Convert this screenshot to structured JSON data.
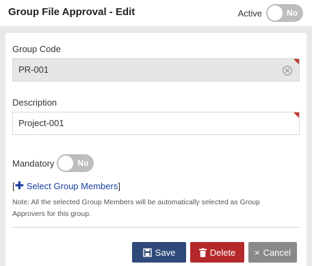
{
  "header": {
    "title": "Group File Approval - Edit",
    "active_label": "Active",
    "active_toggle": "No"
  },
  "form": {
    "group_code_label": "Group Code",
    "group_code_value": "PR-001",
    "description_label": "Description",
    "description_value": "Project-001",
    "mandatory_label": "Mandatory",
    "mandatory_toggle": "No",
    "select_members_open": "[",
    "select_members_label": "Select Group Members",
    "select_members_close": "]",
    "note": "Note: All the selected Group Members will be automatically selected as Group Approvers for this group."
  },
  "buttons": {
    "save": "Save",
    "delete": "Delete",
    "cancel": "Cancel"
  },
  "icons": {
    "save": "save-icon",
    "delete": "trash-icon",
    "cancel": "close-icon",
    "clear": "clear-icon",
    "add": "plus-icon"
  },
  "colors": {
    "save": "#2f4a7a",
    "delete": "#b5282a",
    "cancel": "#8a8a8a",
    "link": "#1a3fa0",
    "required_marker": "#c0392b",
    "toggle_off": "#bdbdbd"
  }
}
